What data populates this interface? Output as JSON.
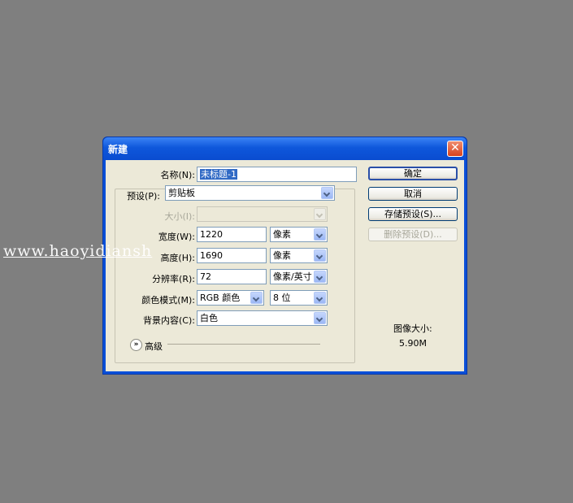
{
  "dialog": {
    "title": "新建",
    "close_label": "✕"
  },
  "form": {
    "name_label": "名称(N):",
    "name_value": "未标题-1",
    "preset_label": "预设(P):",
    "preset_value": "剪贴板",
    "size_label": "大小(I):",
    "size_value": "",
    "width_label": "宽度(W):",
    "width_value": "1220",
    "width_unit": "像素",
    "height_label": "高度(H):",
    "height_value": "1690",
    "height_unit": "像素",
    "resolution_label": "分辨率(R):",
    "resolution_value": "72",
    "resolution_unit": "像素/英寸",
    "color_mode_label": "颜色模式(M):",
    "color_mode_value": "RGB 颜色",
    "bit_depth_value": "8 位",
    "background_label": "背景内容(C):",
    "background_value": "白色",
    "advanced_label": "高级"
  },
  "buttons": {
    "ok": "确定",
    "cancel": "取消",
    "save_preset": "存储预设(S)...",
    "delete_preset": "删除预设(D)..."
  },
  "image_size": {
    "label": "图像大小:",
    "value": "5.90M"
  },
  "watermark": "www.haoyidiansh"
}
